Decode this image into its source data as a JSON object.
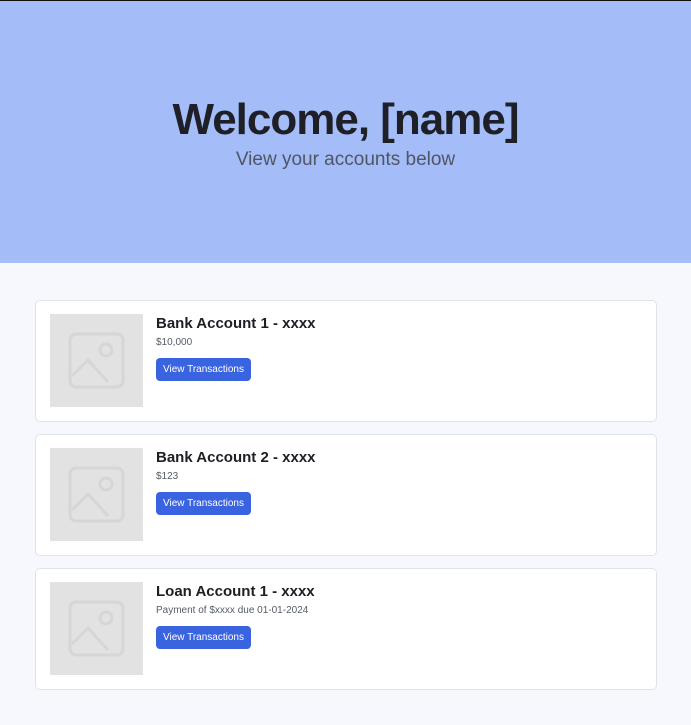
{
  "hero": {
    "title": "Welcome, [name]",
    "subtitle": "View your accounts below"
  },
  "accounts": [
    {
      "title": "Bank Account 1 - xxxx",
      "detail": "$10,000",
      "button_label": "View Transactions",
      "image_icon": "image-placeholder-icon"
    },
    {
      "title": "Bank Account 2 - xxxx",
      "detail": "$123",
      "button_label": "View Transactions",
      "image_icon": "image-placeholder-icon"
    },
    {
      "title": "Loan Account 1 - xxxx",
      "detail": "Payment of $xxxx due 01-01-2024",
      "button_label": "View Transactions",
      "image_icon": "image-placeholder-icon"
    }
  ],
  "colors": {
    "hero_background": "#a4bdf8",
    "page_background": "#f6f8fd",
    "button_background": "#3a63df",
    "placeholder_background": "#e2e2e2"
  }
}
